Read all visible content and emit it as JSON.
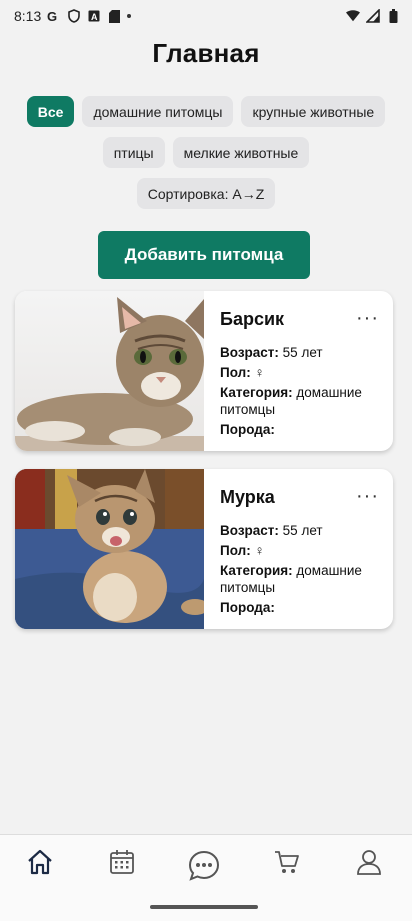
{
  "status_bar": {
    "time": "8:13",
    "icons": [
      "google-icon",
      "shield-icon",
      "a-icon",
      "sd-card-icon",
      "notification-dot-icon",
      "wifi-icon",
      "signal-icon",
      "battery-icon"
    ]
  },
  "header": {
    "title": "Главная"
  },
  "filters": {
    "chips": [
      "Все",
      "домашние питомцы",
      "крупные животные",
      "птицы",
      "мелкие животные"
    ],
    "active": "Все",
    "sort_label": "Сортировка: A→Z"
  },
  "actions": {
    "add_pet_label": "Добавить питомца"
  },
  "labels": {
    "age": "Возраст:",
    "sex": "Пол:",
    "category": "Категория:",
    "breed": "Порода:",
    "more": "···"
  },
  "pets": [
    {
      "name": "Барсик",
      "age": "55 лет",
      "sex": "♀",
      "category": "домашние питомцы",
      "breed": ""
    },
    {
      "name": "Мурка",
      "age": "55 лет",
      "sex": "♀",
      "category": "домашние питомцы",
      "breed": ""
    }
  ],
  "bottom_nav": [
    "home-icon",
    "calendar-icon",
    "chat-icon",
    "cart-icon",
    "profile-icon"
  ],
  "colors": {
    "accent": "#0f7a63",
    "chip": "#e4e4e6",
    "background": "#f2f2f2"
  }
}
